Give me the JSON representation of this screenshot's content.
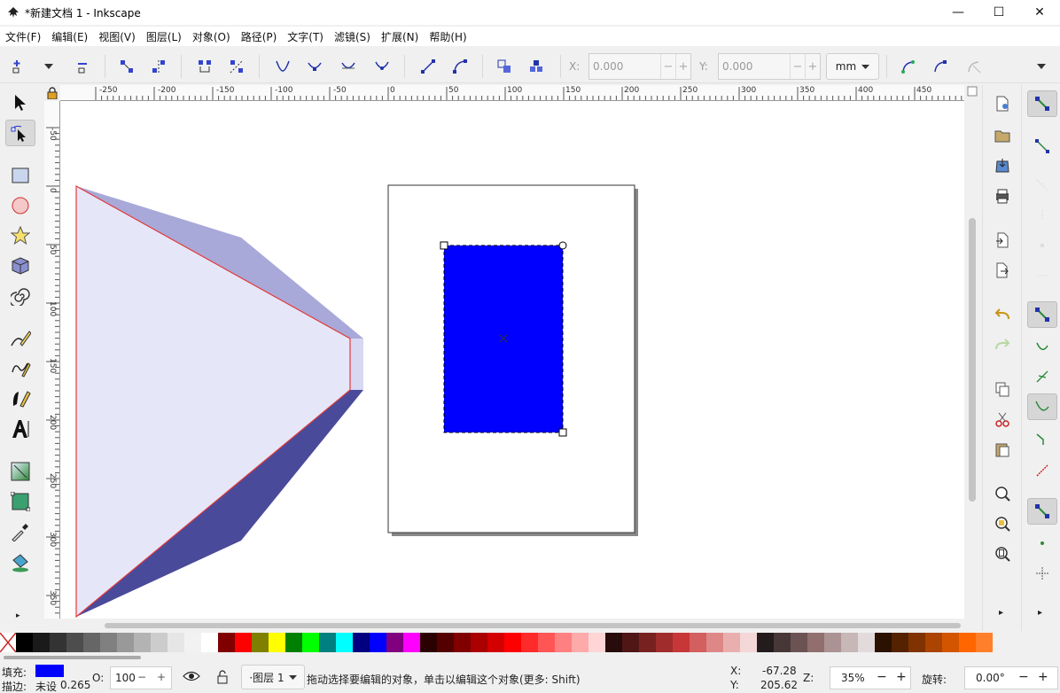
{
  "window": {
    "title": "*新建文档 1 - Inkscape",
    "minimize": "—",
    "maximize": "☐",
    "close": "✕"
  },
  "menu": [
    "文件(F)",
    "编辑(E)",
    "视图(V)",
    "图层(L)",
    "对象(O)",
    "路径(P)",
    "文字(T)",
    "滤镜(S)",
    "扩展(N)",
    "帮助(H)"
  ],
  "toolbar": {
    "x_label": "X:",
    "x_value": "0.000",
    "y_label": "Y:",
    "y_value": "0.000",
    "unit": "mm",
    "minus": "−",
    "plus": "+"
  },
  "rulers": {
    "top_labels": [
      "-250",
      "-200",
      "-150",
      "-100",
      "-50",
      "0",
      "50",
      "100",
      "150",
      "200",
      "250",
      "300",
      "350",
      "400",
      "450"
    ],
    "left_labels": [
      "-50",
      "0",
      "50",
      "100",
      "150",
      "200",
      "250",
      "300",
      "350"
    ]
  },
  "canvas": {
    "selected_fill": "#0000ff",
    "trapezoid_fill": "#e6e6f9",
    "trapezoid_top_fill": "#a8a9d8",
    "trapezoid_bottom_fill": "#4a4a9a",
    "trapezoid_stroke": "#e23b3b"
  },
  "palette": [
    "#000000",
    "#1a1a1a",
    "#333333",
    "#4d4d4d",
    "#666666",
    "#808080",
    "#999999",
    "#b3b3b3",
    "#cccccc",
    "#e6e6e6",
    "#f2f2f2",
    "#ffffff",
    "#800000",
    "#ff0000",
    "#808000",
    "#ffff00",
    "#008000",
    "#00ff00",
    "#008080",
    "#00ffff",
    "#000080",
    "#0000ff",
    "#800080",
    "#ff00ff",
    "#2b0000",
    "#550000",
    "#800000",
    "#aa0000",
    "#d40000",
    "#ff0000",
    "#ff2a2a",
    "#ff5555",
    "#ff8080",
    "#ffaaaa",
    "#ffd5d5",
    "#280b0b",
    "#501616",
    "#782121",
    "#a02c2c",
    "#c83737",
    "#d35f5f",
    "#de8787",
    "#e9afaf",
    "#f4d7d7",
    "#241c1c",
    "#483737",
    "#6c5353",
    "#916f6f",
    "#ac9393",
    "#c8b7b7",
    "#e3dbdb",
    "#2b1100",
    "#552200",
    "#803300",
    "#aa4400",
    "#d45500",
    "#ff6600",
    "#ff7f2a"
  ],
  "status": {
    "fill_label": "填充:",
    "stroke_label": "描边:",
    "stroke_value": "未设",
    "stroke_width": "0.265",
    "opacity_label": "O:",
    "opacity_value": "100",
    "layer": "·图层 1",
    "message": "拖动选择要编辑的对象，单击以编辑这个对象(更多: Shift)",
    "cursor_x_label": "X:",
    "cursor_x": "-67.28",
    "cursor_y_label": "Y:",
    "cursor_y": "205.62",
    "zoom_label": "Z:",
    "zoom": "35%",
    "rotate_label": "旋转:",
    "rotate": "0.00°",
    "fill_color": "#0000ff",
    "minus": "−",
    "plus": "+"
  }
}
